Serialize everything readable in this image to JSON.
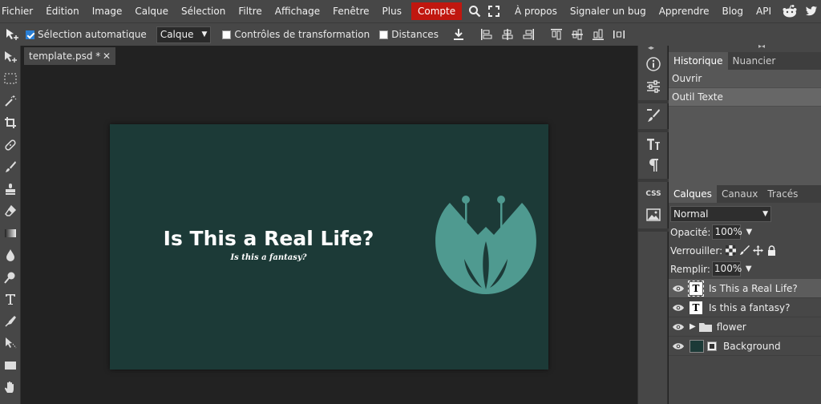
{
  "menu": {
    "items": [
      "Fichier",
      "Édition",
      "Image",
      "Calque",
      "Sélection",
      "Filtre",
      "Affichage",
      "Fenêtre",
      "Plus"
    ],
    "account": "Compte",
    "right_items": [
      "À propos",
      "Signaler un bug",
      "Apprendre",
      "Blog",
      "API"
    ]
  },
  "options": {
    "auto_select_label": "Sélection automatique",
    "target_value": "Calque",
    "transform_controls_label": "Contrôles de transformation",
    "distances_label": "Distances"
  },
  "document": {
    "tab_name": "template.psd *",
    "title_text": "Is This a Real Life?",
    "subtitle_text": "Is this a fantasy?"
  },
  "side_buttons": {
    "css_label": "CSS"
  },
  "history": {
    "tabs": [
      "Historique",
      "Nuancier"
    ],
    "items": [
      "Ouvrir",
      "Outil Texte"
    ]
  },
  "layers": {
    "tabs": [
      "Calques",
      "Canaux",
      "Tracés"
    ],
    "blend_mode": "Normal",
    "opacity_label": "Opacité:",
    "opacity_value": "100%",
    "lock_label": "Verrouiller:",
    "fill_label": "Remplir:",
    "fill_value": "100%",
    "list": [
      {
        "name": "Is This a Real Life?",
        "type": "text"
      },
      {
        "name": "Is this a fantasy?",
        "type": "text"
      },
      {
        "name": "flower",
        "type": "folder"
      },
      {
        "name": "Background",
        "type": "image"
      }
    ]
  },
  "colors": {
    "canvas_bg": "#1c3a37",
    "flower": "#4f9a90",
    "account_red": "#c0170f"
  }
}
